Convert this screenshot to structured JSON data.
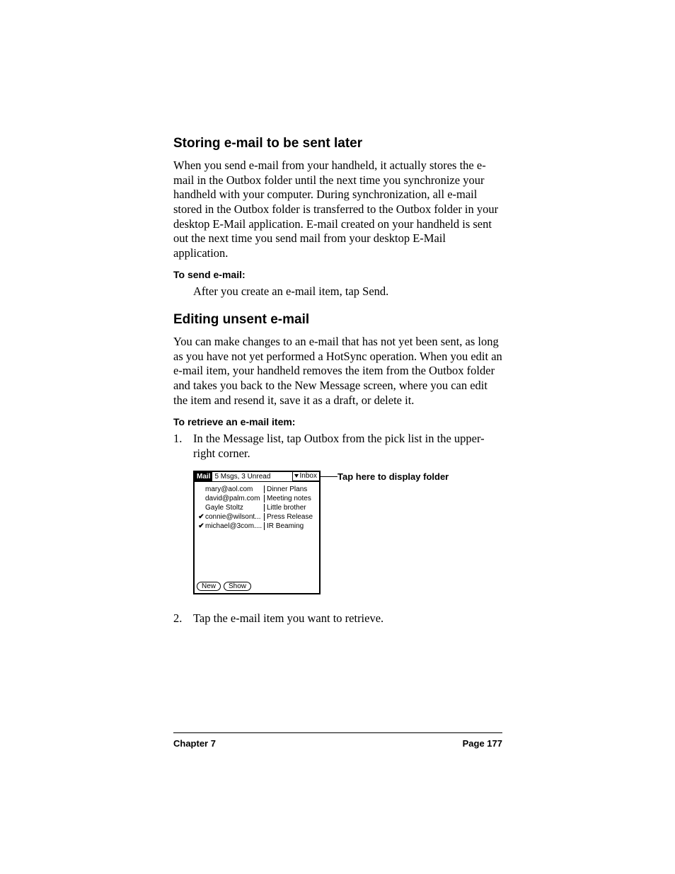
{
  "section1": {
    "heading": "Storing e-mail to be sent later",
    "para": "When you send e-mail from your handheld, it actually stores the e-mail in the Outbox folder until the next time you synchronize your handheld with your computer. During synchronization, all e-mail stored in the Outbox folder is transferred to the Outbox folder in your desktop E-Mail application. E-mail created on your handheld is sent out the next time you send mail from your desktop E-Mail application.",
    "sub_label": "To send e-mail:",
    "sub_text": "After you create an e-mail item, tap Send."
  },
  "section2": {
    "heading": "Editing unsent e-mail",
    "para": "You can make changes to an e-mail that has not yet been sent, as long as you have not yet performed a HotSync operation. When you edit an e-mail item, your handheld removes the item from the Outbox folder and takes you back to the New Message screen, where you can edit the item and resend it, save it as a draft, or delete it.",
    "sub_label": "To retrieve an e-mail item:",
    "steps": [
      {
        "num": "1.",
        "text": "In the Message list, tap Outbox from the pick list in the upper-right corner."
      },
      {
        "num": "2.",
        "text": "Tap the e-mail item you want to retrieve."
      }
    ]
  },
  "device": {
    "app": "Mail",
    "status": "5 Msgs, 3 Unread",
    "folder": "Inbox",
    "rows": [
      {
        "check": false,
        "from": "mary@aol.com",
        "subj": "Dinner Plans"
      },
      {
        "check": false,
        "from": "david@palm.com",
        "subj": "Meeting notes"
      },
      {
        "check": false,
        "from": "Gayle Stoltz",
        "subj": "Little brother"
      },
      {
        "check": true,
        "from": "connie@wilsont...",
        "subj": "Press Release"
      },
      {
        "check": true,
        "from": "michael@3com....",
        "subj": "IR Beaming"
      }
    ],
    "buttons": {
      "new": "New",
      "show": "Show"
    },
    "callout": "Tap here to display folder"
  },
  "footer": {
    "chapter": "Chapter 7",
    "page": "Page 177"
  }
}
